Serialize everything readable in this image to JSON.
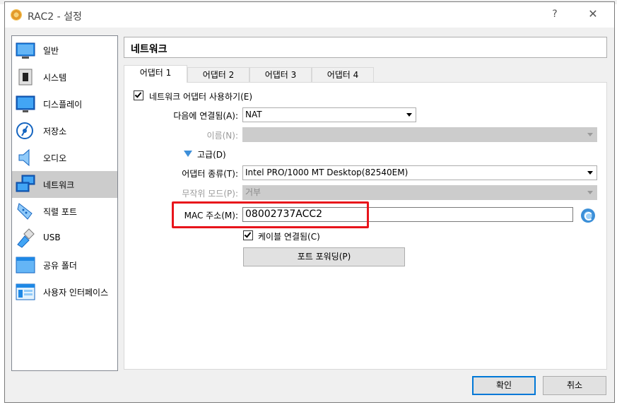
{
  "window": {
    "title": "RAC2 - 설정",
    "help_label": "?",
    "close_label": "✕"
  },
  "sidebar": {
    "items": [
      {
        "label": "일반",
        "icon": "general-icon"
      },
      {
        "label": "시스템",
        "icon": "system-icon"
      },
      {
        "label": "디스플레이",
        "icon": "display-icon"
      },
      {
        "label": "저장소",
        "icon": "storage-icon"
      },
      {
        "label": "오디오",
        "icon": "audio-icon"
      },
      {
        "label": "네트워크",
        "icon": "network-icon",
        "selected": true
      },
      {
        "label": "직렬 포트",
        "icon": "serial-port-icon"
      },
      {
        "label": "USB",
        "icon": "usb-icon"
      },
      {
        "label": "공유 폴더",
        "icon": "shared-folder-icon"
      },
      {
        "label": "사용자 인터페이스",
        "icon": "user-interface-icon"
      }
    ]
  },
  "header": {
    "title": "네트워크"
  },
  "tabs": [
    {
      "label": "어댑터 1",
      "active": true
    },
    {
      "label": "어댑터 2"
    },
    {
      "label": "어댑터 3"
    },
    {
      "label": "어댑터 4"
    }
  ],
  "adapter": {
    "enable_label": "네트워크 어댑터 사용하기(E)",
    "enable_checked": true,
    "attached_label": "다음에 연결됨(A):",
    "attached_value": "NAT",
    "name_label": "이름(N):",
    "name_value": "",
    "advanced_label": "고급(D)",
    "type_label": "어댑터 종류(T):",
    "type_value": "Intel PRO/1000 MT Desktop(82540EM)",
    "promisc_label": "무작위 모드(P):",
    "promisc_value": "거부",
    "mac_label": "MAC 주소(M):",
    "mac_value": "08002737ACC2",
    "cable_label": "케이블 연결됨(C)",
    "cable_checked": true,
    "port_forward_label": "포트 포워딩(P)"
  },
  "footer": {
    "ok_label": "확인",
    "cancel_label": "취소"
  },
  "colors": {
    "highlight": "#e8141b",
    "accent": "#0078d7",
    "selected_bg": "#cccccc"
  }
}
